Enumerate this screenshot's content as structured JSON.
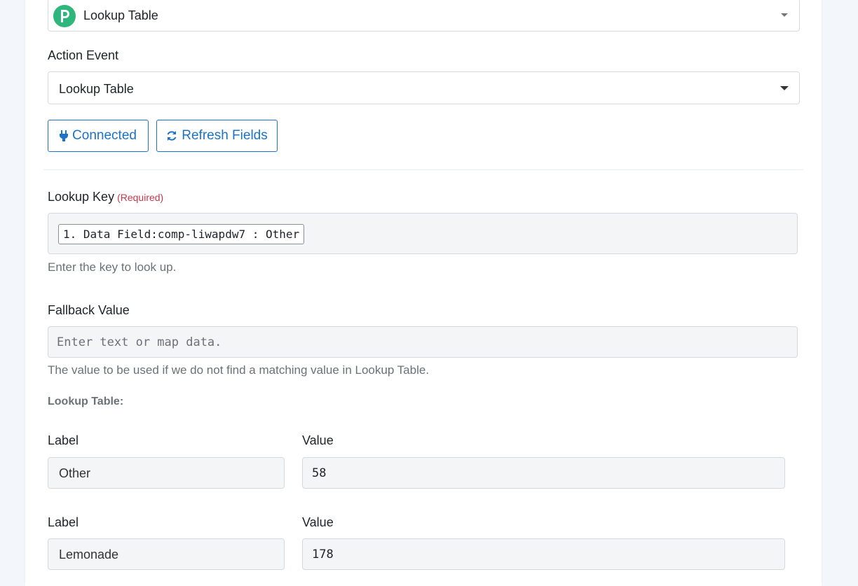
{
  "app_select": {
    "value": "Lookup Table",
    "logo_letter": "P"
  },
  "action_event": {
    "label": "Action Event",
    "value": "Lookup Table"
  },
  "buttons": {
    "connected": "Connected",
    "refresh": "Refresh Fields"
  },
  "lookup_key": {
    "label": "Lookup Key",
    "required": "(Required)",
    "token": "1. Data Field:comp-liwapdw7 : Other",
    "help": "Enter the key to look up."
  },
  "fallback": {
    "label": "Fallback Value",
    "placeholder": "Enter text or map data.",
    "help": "The value to be used if we do not find a matching value in Lookup Table."
  },
  "lookup_table": {
    "title": "Lookup Table:",
    "rows": [
      {
        "label_heading": "Label",
        "value_heading": "Value",
        "label": "Other",
        "value": "58"
      },
      {
        "label_heading": "Label",
        "value_heading": "Value",
        "label": "Lemonade",
        "value": "178"
      }
    ]
  },
  "colors": {
    "accent": "#1a73c8",
    "required": "#c8364d",
    "brand": "#2fb67c"
  }
}
